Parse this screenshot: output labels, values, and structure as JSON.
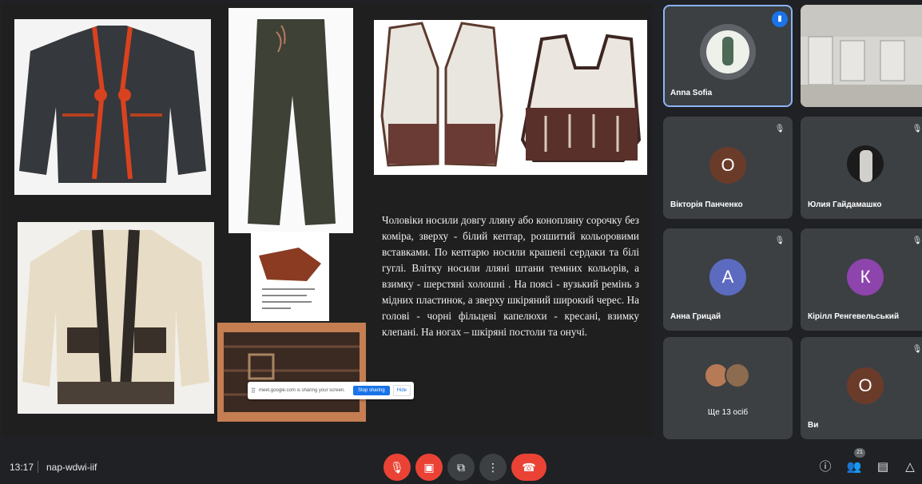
{
  "slide": {
    "text": "Чоловіки носили довгу лляну або конопляну сорочку без коміра, зверху - білий кептар, розшитий кольоровими вставками. По кептарю носили крашені сердаки та білі гуглі. Влітку носили лляні штани темних кольорів, а взимку - шерстяні холошні . На поясі - вузький ремінь з мідних пластинок, а зверху шкіряний широкий черес. На голові - чорні фільцеві капелюхи - кресані, взимку клепані. На ногах – шкіряні постоли та онучі.",
    "share_notice": "meet.google.com is sharing your screen.",
    "share_stop": "Stop sharing",
    "share_hide": "Hide"
  },
  "participants": [
    {
      "name": "Anna Sofia",
      "type": "photo",
      "speaking": true
    },
    {
      "name": "",
      "type": "room"
    },
    {
      "name": "Вікторія Панченко",
      "initial": "О",
      "color": "#6b3b2a"
    },
    {
      "name": "Юлия Гайдамашко",
      "type": "photo-dark"
    },
    {
      "name": "Анна Грицай",
      "initial": "А",
      "color": "#5c6bc0"
    },
    {
      "name": "Кірілл Ренгевельський",
      "initial": "К",
      "color": "#8e44ad"
    },
    {
      "name": "Ще 13 осіб",
      "type": "group"
    },
    {
      "name": "Ви",
      "initial": "О",
      "color": "#6b3b2a"
    }
  ],
  "bottom": {
    "time": "13:17",
    "meeting_code": "nap-wdwi-iif",
    "people_count": "21"
  },
  "icons": {
    "mic_off": "mic-off-icon",
    "cam_off": "camera-off-icon",
    "present": "present-icon",
    "more": "more-vert-icon",
    "hangup": "phone-hangup-icon",
    "info": "info-icon",
    "people": "people-icon",
    "chat": "chat-icon",
    "activities": "activities-icon"
  }
}
